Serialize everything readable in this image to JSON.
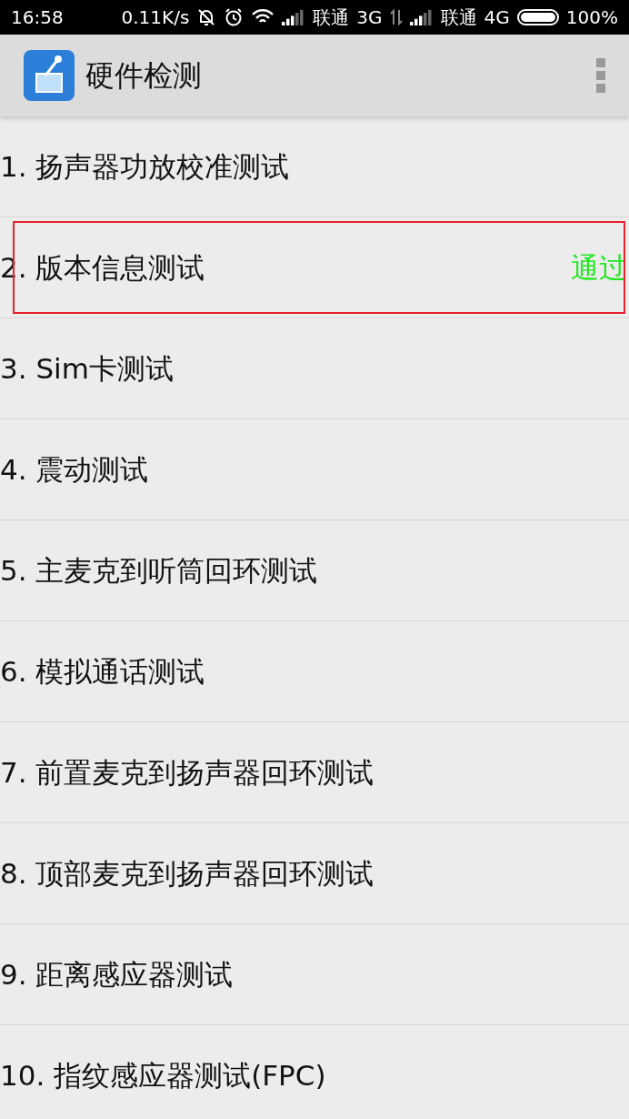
{
  "status_bar": {
    "time": "16:58",
    "speed": "0.11K/s",
    "carriers": [
      {
        "name": "联通",
        "network": "3G"
      },
      {
        "name": "联通",
        "network": "4G"
      }
    ],
    "battery": "100%"
  },
  "app_bar": {
    "title": "硬件检测"
  },
  "tests": [
    {
      "label": "1. 扬声器功放校准测试",
      "highlighted": false
    },
    {
      "label": "2. 版本信息测试",
      "result": "通过",
      "highlighted": true
    },
    {
      "label": "3. Sim卡测试",
      "highlighted": false
    },
    {
      "label": "4. 震动测试",
      "highlighted": false
    },
    {
      "label": "5. 主麦克到听筒回环测试",
      "highlighted": false
    },
    {
      "label": "6. 模拟通话测试",
      "highlighted": false
    },
    {
      "label": "7. 前置麦克到扬声器回环测试",
      "highlighted": false
    },
    {
      "label": "8. 顶部麦克到扬声器回环测试",
      "highlighted": false
    },
    {
      "label": "9. 距离感应器测试",
      "highlighted": false
    },
    {
      "label": "10. 指纹感应器测试(FPC)",
      "highlighted": false
    }
  ]
}
